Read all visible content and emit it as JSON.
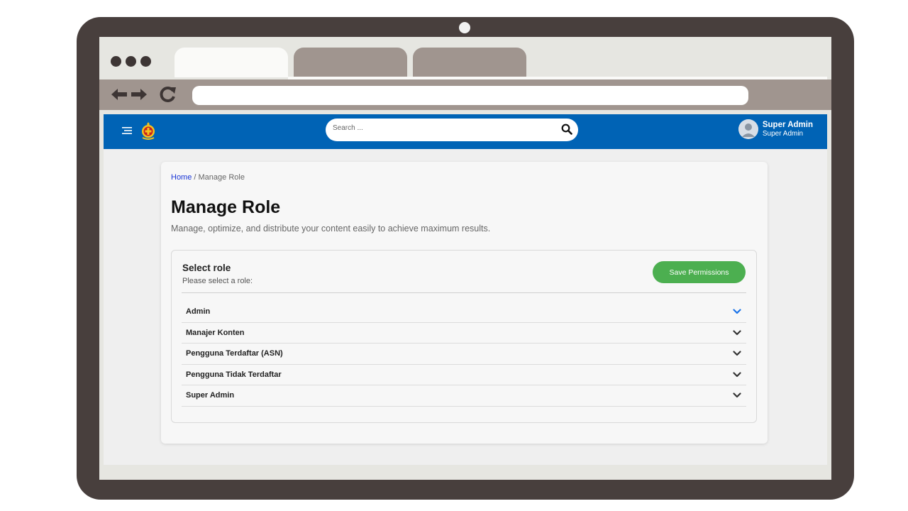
{
  "header": {
    "search_placeholder": "Search ...",
    "user_name": "Super Admin",
    "user_role": "Super Admin"
  },
  "breadcrumb": {
    "home": "Home",
    "separator": " / ",
    "current": "Manage Role"
  },
  "page": {
    "title": "Manage Role",
    "subtitle": "Manage, optimize, and distribute your content easily to achieve maximum results."
  },
  "panel": {
    "title": "Select role",
    "subtitle": "Please select a role:",
    "save_label": "Save Permissions"
  },
  "roles": [
    {
      "label": "Admin",
      "active": true
    },
    {
      "label": "Manajer Konten",
      "active": false
    },
    {
      "label": "Pengguna Terdaftar (ASN)",
      "active": false
    },
    {
      "label": "Pengguna Tidak Terdaftar",
      "active": false
    },
    {
      "label": "Super Admin",
      "active": false
    }
  ],
  "colors": {
    "appbar": "#0063b5",
    "accent": "#1a73e8",
    "save": "#4caf50"
  }
}
